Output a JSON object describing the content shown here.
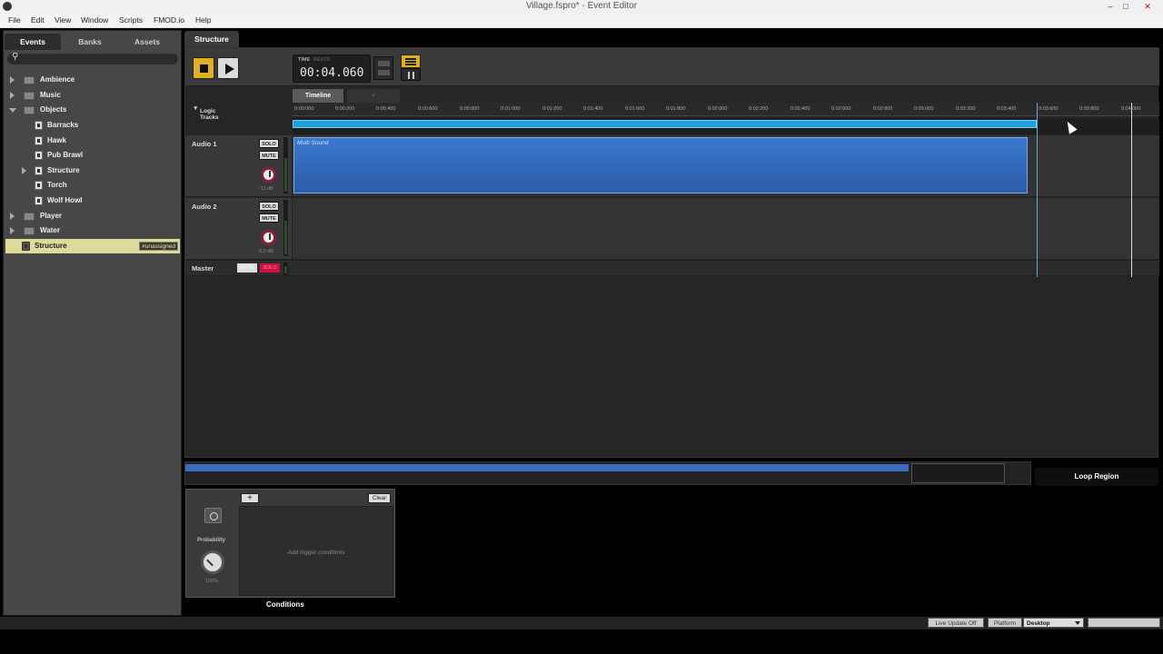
{
  "window": {
    "title": "Village.fspro* - Event Editor",
    "minimize": "–",
    "maximize": "□",
    "close": "✕"
  },
  "menu": [
    "File",
    "Edit",
    "View",
    "Window",
    "Scripts",
    "FMOD.io",
    "Help"
  ],
  "browser": {
    "tabs": [
      "Events",
      "Banks",
      "Assets"
    ],
    "search_icon": "⚲",
    "tree": [
      {
        "label": "Ambience",
        "type": "folder"
      },
      {
        "label": "Music",
        "type": "folder"
      },
      {
        "label": "Objects",
        "type": "folder"
      },
      {
        "label": "Barracks",
        "type": "event"
      },
      {
        "label": "Hawk",
        "type": "event"
      },
      {
        "label": "Pub Brawl",
        "type": "event"
      },
      {
        "label": "Structure",
        "type": "event"
      },
      {
        "label": "Torch",
        "type": "event"
      },
      {
        "label": "Wolf Howl",
        "type": "event"
      },
      {
        "label": "Player",
        "type": "folder"
      },
      {
        "label": "Water",
        "type": "folder"
      },
      {
        "label": "Structure",
        "type": "event",
        "badge": "#unassigned"
      }
    ]
  },
  "editor": {
    "tab": "Structure",
    "time_label": "TIME",
    "beats_label": "BEATS",
    "time_value": "00:04.060",
    "timeline_tab": "Timeline",
    "add_tab": "+",
    "logic_tracks": "Logic Tracks",
    "ruler": [
      "0:00:000",
      "0:00:200",
      "0:00:400",
      "0:00:600",
      "0:00:800",
      "0:01:000",
      "0:01:200",
      "0:01:400",
      "0:01:600",
      "0:01:800",
      "0:02:000",
      "0:02:200",
      "0:02:400",
      "0:02:600",
      "0:02:800",
      "0:03:000",
      "0:03:200",
      "0:03:400",
      "0:03:600",
      "0:03:800",
      "0:04:000"
    ],
    "tracks": [
      {
        "name": "Audio 1",
        "solo": "SOLO",
        "mute": "MUTE",
        "db": "-11 dB",
        "instrument": "Multi Sound"
      },
      {
        "name": "Audio 2",
        "solo": "SOLO",
        "mute": "MUTE",
        "db": "0.0 dB"
      }
    ],
    "master": {
      "name": "Master",
      "mute": "MUTE",
      "solo": "SOLO"
    }
  },
  "deck": {
    "loop_region": "Loop Region",
    "add": "+",
    "clear": "Clear",
    "probability_label": "Probability",
    "probability_value": "100%",
    "placeholder": "Add trigger conditions",
    "caption": "Conditions"
  },
  "status": {
    "live_update": "Live Update Off",
    "platform_label": "Platform",
    "platform_value": "Desktop"
  }
}
